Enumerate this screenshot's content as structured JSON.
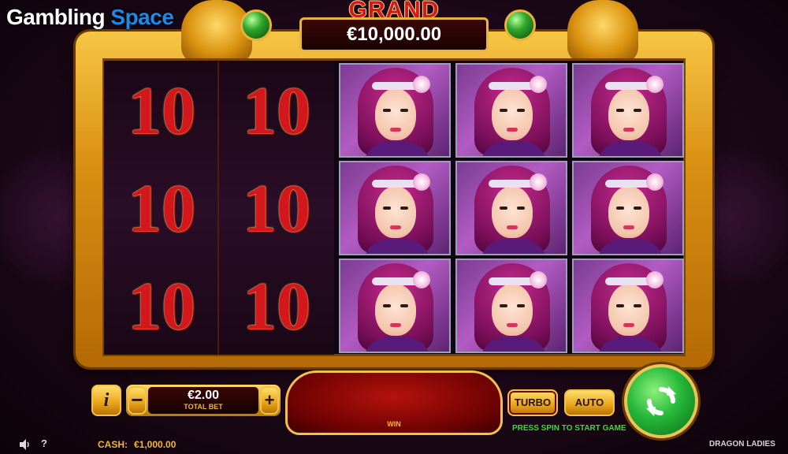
{
  "brand": {
    "word1": "Gambling",
    "word2": "Space"
  },
  "jackpot": {
    "title": "GRAND",
    "amount": "€10,000.00"
  },
  "reels": [
    {
      "symbols": [
        "10",
        "10",
        "10"
      ]
    },
    {
      "symbols": [
        "10",
        "10",
        "10"
      ]
    },
    {
      "symbols": [
        "lady",
        "lady",
        "lady"
      ]
    },
    {
      "symbols": [
        "lady",
        "lady",
        "lady"
      ]
    },
    {
      "symbols": [
        "lady",
        "lady",
        "lady"
      ]
    }
  ],
  "controls": {
    "info_label": "i",
    "minus_label": "−",
    "plus_label": "+",
    "bet_value": "€2.00",
    "bet_label": "TOTAL BET",
    "win_label": "WIN",
    "turbo_label": "TURBO",
    "auto_label": "AUTO",
    "press_message": "PRESS SPIN TO START GAME"
  },
  "footer": {
    "cash_label": "CASH:",
    "cash_value": "€1,000.00",
    "help_label": "?",
    "game_name": "DRAGON LADIES"
  },
  "icons": {
    "spin": "refresh-arrows-icon",
    "sound": "speaker-icon",
    "gem": "green-gem-icon"
  },
  "colors": {
    "frame_gold": "#e8a418",
    "jackpot_red": "#d11a1a",
    "spin_green": "#26b83a",
    "text_gold": "#f0b832",
    "message_green": "#46d63c"
  }
}
